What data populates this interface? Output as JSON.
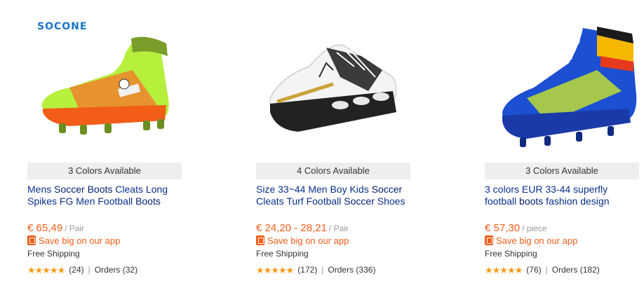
{
  "products": [
    {
      "brand_logo": "SOCONE",
      "colors": "3 Colors Available",
      "title_parts": [
        "Mens ",
        "Soccer Boots",
        " Cleats Long Spikes FG Men Football ",
        "Boots"
      ],
      "price": "€ 65,49",
      "unit": "/ Pair",
      "app_promo": "Save big on our app",
      "shipping": "Free Shipping",
      "stars": "★★★★★",
      "reviews": "(24)",
      "orders": "Orders (32)",
      "rating": 5,
      "shoe_colors": {
        "body": "#b6f03c",
        "accent": "#f5732a",
        "sole": "#f25d18"
      }
    },
    {
      "colors": "4 Colors Available",
      "title_parts": [
        "Size 33~44 Men Boy Kids ",
        "Soccer",
        " Cleats Turf Football ",
        "Soccer",
        " Shoes"
      ],
      "price": "€ 24,20 - 28,21",
      "unit": "/ Pair",
      "app_promo": "Save big on our app",
      "shipping": "Free Shipping",
      "stars": "★★★★★",
      "reviews": "(172)",
      "orders": "Orders (336)",
      "rating": 4.5,
      "shoe_colors": {
        "body": "#f4f4f4",
        "accent": "#1a1a1a",
        "sole": "#222222"
      }
    },
    {
      "colors": "3 Colors Available",
      "title_parts": [
        "3 colors EUR 33-44 superfly football ",
        "boots",
        " fashion design"
      ],
      "price": "€ 57,30",
      "unit": "/ piece",
      "app_promo": "Save big on our app",
      "shipping": "Free Shipping",
      "stars": "★★★★★",
      "reviews": "(76)",
      "orders": "Orders (182)",
      "rating": 4.5,
      "shoe_colors": {
        "body": "#1c4fd1",
        "accent": "#c8e62a",
        "sole": "#1a3aa8"
      }
    }
  ]
}
